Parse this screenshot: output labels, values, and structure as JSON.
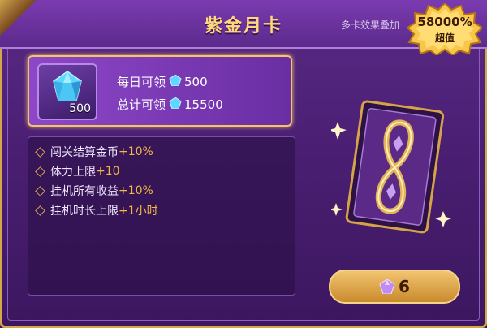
{
  "header": {
    "title": "紫金月卡",
    "stack_note": "多卡效果叠加"
  },
  "badge": {
    "percent": "58000%",
    "sub": "超值"
  },
  "reward": {
    "gem_count": "500",
    "daily_label": "每日可领",
    "daily_value": "500",
    "total_label": "总计可领",
    "total_value": "15500"
  },
  "effects": [
    {
      "label": "闯关结算金币",
      "value": "+10%"
    },
    {
      "label": "体力上限",
      "value": "+10"
    },
    {
      "label": "挂机所有收益",
      "value": "+10%"
    },
    {
      "label": "挂机时长上限",
      "value": "+1小时"
    }
  ],
  "price": {
    "value": "6",
    "icon": "purple-gem-icon"
  },
  "colors": {
    "accent_gold": "#f4c46b",
    "highlight_value": "#f4b74a",
    "panel_purple": "#5a2a86"
  }
}
